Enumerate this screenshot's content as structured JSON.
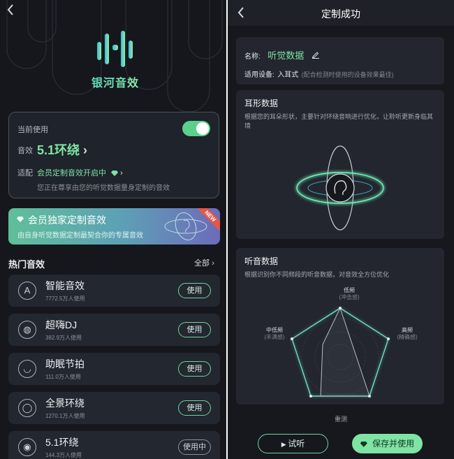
{
  "left": {
    "back_icon": "chevron-left-icon",
    "logo_text": "银河音效",
    "current": {
      "label": "当前使用",
      "toggle_on": true,
      "effect_label": "音效",
      "effect_value": "5.1环绕",
      "adapt_label": "适配",
      "adapt_value": "会员定制音效开启中",
      "note": "您正在尊享由您的听觉数据量身定制的音效"
    },
    "banner": {
      "title": "会员独家定制音效",
      "subtitle": "由自身听觉数据定制最契合你的专属音效",
      "tag": "NEW"
    },
    "hot": {
      "title": "热门音效",
      "all_label": "全部",
      "items": [
        {
          "icon": "letter-a-icon",
          "glyph": "A",
          "name": "智能音效",
          "users": "7772.5万人使用",
          "button": "使用"
        },
        {
          "icon": "globe-icon",
          "glyph": "◍",
          "name": "超嗨DJ",
          "users": "382.9万人使用",
          "button": "使用"
        },
        {
          "icon": "sleep-eye-icon",
          "glyph": "◡",
          "name": "助眠节拍",
          "users": "111.0万人使用",
          "button": "使用"
        },
        {
          "icon": "surround-icon",
          "glyph": "◯",
          "name": "全景环绕",
          "users": "1270.1万人使用",
          "button": "使用"
        },
        {
          "icon": "speaker-icon",
          "glyph": "◉",
          "name": "5.1环绕",
          "users": "144.3万人使用",
          "button": "使用中"
        }
      ]
    }
  },
  "right": {
    "back_icon": "chevron-left-icon",
    "title": "定制成功",
    "name_label": "名称:",
    "name_value": "听觉数据",
    "device_label": "适用设备:",
    "device_value": "入耳式",
    "device_hint": "(配合检测时使用的设备效果最佳)",
    "ear": {
      "title": "耳形数据",
      "desc": "根据您的耳朵形状，主要针对环绕音响进行优化，让聆听更新身临其境"
    },
    "hearing": {
      "title": "听音数据",
      "desc": "根据识别你不同频段的听音数据，对音效全方位优化",
      "axes": [
        {
          "name": "低频",
          "sub": "(冲击感)"
        },
        {
          "name": "高频",
          "sub": "(精确感)"
        },
        {
          "name": "中低频",
          "sub": "(丰满感)"
        }
      ]
    },
    "retest": "重测",
    "listen_button": "试听",
    "save_button": "保存并使用"
  }
}
